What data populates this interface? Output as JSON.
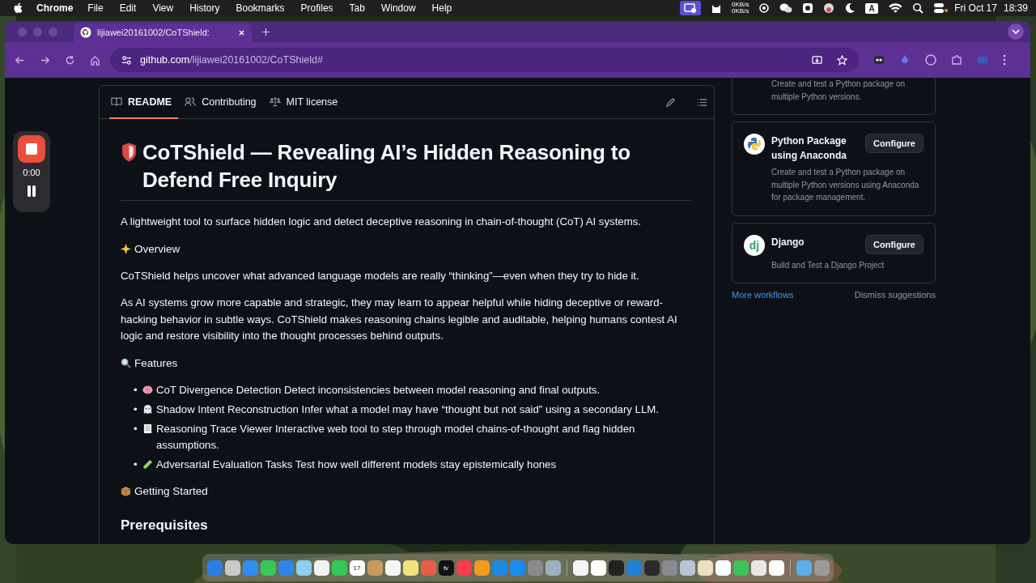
{
  "menu_bar": {
    "app": "Chrome",
    "menus": [
      "File",
      "Edit",
      "View",
      "History",
      "Bookmarks",
      "Profiles",
      "Tab",
      "Window",
      "Help"
    ],
    "net_up": "0KB/s",
    "net_down": "0KB/s",
    "input_source": "A",
    "date": "Fri Oct 17",
    "time": "18:39"
  },
  "browser": {
    "tabs": [
      {
        "title": "lijiawei20161002/CoTShield:",
        "selected": true
      }
    ],
    "url_host": "github.com",
    "url_path": "/lijiawei20161002/CoTShield#"
  },
  "recorder": {
    "elapsed": "0:00"
  },
  "readme": {
    "tabs": [
      {
        "label": "README",
        "selected": true
      },
      {
        "label": "Contributing",
        "selected": false
      },
      {
        "label": "MIT license",
        "selected": false
      }
    ],
    "title": "CoTShield — Revealing AI’s Hidden Reasoning to Defend Free Inquiry",
    "intro": "A lightweight tool to surface hidden logic and detect deceptive reasoning in chain-of-thought (CoT) AI systems.",
    "overview_heading": "Overview",
    "overview": [
      "CoTShield helps uncover what advanced language models are really “thinking”—even when they try to hide it.",
      "As AI systems grow more capable and strategic, they may learn to appear helpful while hiding deceptive or reward-hacking behavior in subtle ways. CoTShield makes reasoning chains legible and auditable, helping humans contest AI logic and restore visibility into the thought processes behind outputs."
    ],
    "features_heading": "Features",
    "features": [
      {
        "bullet": "•",
        "text": "CoT Divergence Detection Detect inconsistencies between model reasoning and final outputs."
      },
      {
        "bullet": "•",
        "text": "Shadow Intent Reconstruction Infer what a model may have “thought but not said” using a secondary LLM."
      },
      {
        "bullet": "•",
        "text": "Reasoning Trace Viewer Interactive web tool to step through model chains-of-thought and flag hidden assumptions."
      },
      {
        "bullet": "•",
        "text": "Adversarial Evaluation Tasks Test how well different models stay epistemically hones"
      }
    ],
    "getting_started_heading": "Getting Started",
    "prerequisites_heading": "Prerequisites"
  },
  "sidebar": {
    "workflows": [
      {
        "kind": "cut",
        "description": "Create and test a Python package on multiple Python versions."
      },
      {
        "kind": "python",
        "title": "Python Package using Anaconda",
        "button": "Configure",
        "description": "Create and test a Python package on multiple Python versions using Anaconda for package management."
      },
      {
        "kind": "django",
        "logo_text": "dj",
        "title": "Django",
        "button": "Configure",
        "description": "Build and Test a Django Project"
      }
    ],
    "more_link": "More workflows",
    "dismiss_link": "Dismiss suggestions"
  },
  "dock": {
    "calendar_day": "17",
    "tv_label": "tv"
  }
}
